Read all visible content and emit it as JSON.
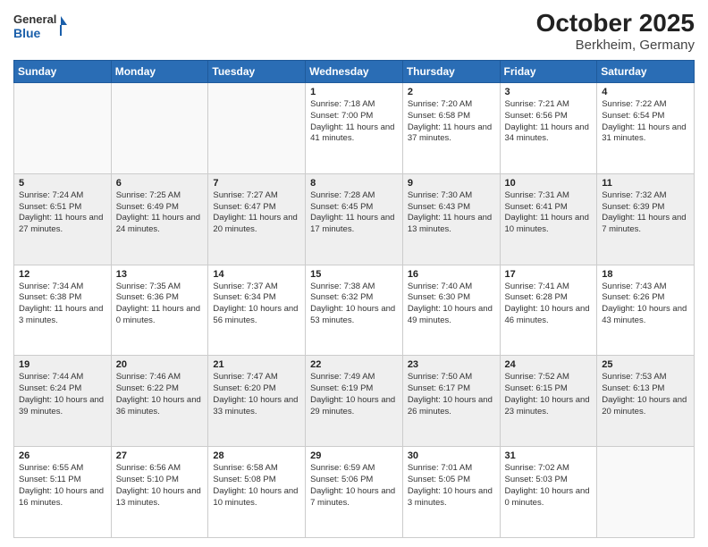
{
  "header": {
    "logo_general": "General",
    "logo_blue": "Blue",
    "month_year": "October 2025",
    "location": "Berkheim, Germany"
  },
  "days_of_week": [
    "Sunday",
    "Monday",
    "Tuesday",
    "Wednesday",
    "Thursday",
    "Friday",
    "Saturday"
  ],
  "weeks": [
    [
      {
        "day": "",
        "info": ""
      },
      {
        "day": "",
        "info": ""
      },
      {
        "day": "",
        "info": ""
      },
      {
        "day": "1",
        "info": "Sunrise: 7:18 AM\nSunset: 7:00 PM\nDaylight: 11 hours and 41 minutes."
      },
      {
        "day": "2",
        "info": "Sunrise: 7:20 AM\nSunset: 6:58 PM\nDaylight: 11 hours and 37 minutes."
      },
      {
        "day": "3",
        "info": "Sunrise: 7:21 AM\nSunset: 6:56 PM\nDaylight: 11 hours and 34 minutes."
      },
      {
        "day": "4",
        "info": "Sunrise: 7:22 AM\nSunset: 6:54 PM\nDaylight: 11 hours and 31 minutes."
      }
    ],
    [
      {
        "day": "5",
        "info": "Sunrise: 7:24 AM\nSunset: 6:51 PM\nDaylight: 11 hours and 27 minutes."
      },
      {
        "day": "6",
        "info": "Sunrise: 7:25 AM\nSunset: 6:49 PM\nDaylight: 11 hours and 24 minutes."
      },
      {
        "day": "7",
        "info": "Sunrise: 7:27 AM\nSunset: 6:47 PM\nDaylight: 11 hours and 20 minutes."
      },
      {
        "day": "8",
        "info": "Sunrise: 7:28 AM\nSunset: 6:45 PM\nDaylight: 11 hours and 17 minutes."
      },
      {
        "day": "9",
        "info": "Sunrise: 7:30 AM\nSunset: 6:43 PM\nDaylight: 11 hours and 13 minutes."
      },
      {
        "day": "10",
        "info": "Sunrise: 7:31 AM\nSunset: 6:41 PM\nDaylight: 11 hours and 10 minutes."
      },
      {
        "day": "11",
        "info": "Sunrise: 7:32 AM\nSunset: 6:39 PM\nDaylight: 11 hours and 7 minutes."
      }
    ],
    [
      {
        "day": "12",
        "info": "Sunrise: 7:34 AM\nSunset: 6:38 PM\nDaylight: 11 hours and 3 minutes."
      },
      {
        "day": "13",
        "info": "Sunrise: 7:35 AM\nSunset: 6:36 PM\nDaylight: 11 hours and 0 minutes."
      },
      {
        "day": "14",
        "info": "Sunrise: 7:37 AM\nSunset: 6:34 PM\nDaylight: 10 hours and 56 minutes."
      },
      {
        "day": "15",
        "info": "Sunrise: 7:38 AM\nSunset: 6:32 PM\nDaylight: 10 hours and 53 minutes."
      },
      {
        "day": "16",
        "info": "Sunrise: 7:40 AM\nSunset: 6:30 PM\nDaylight: 10 hours and 49 minutes."
      },
      {
        "day": "17",
        "info": "Sunrise: 7:41 AM\nSunset: 6:28 PM\nDaylight: 10 hours and 46 minutes."
      },
      {
        "day": "18",
        "info": "Sunrise: 7:43 AM\nSunset: 6:26 PM\nDaylight: 10 hours and 43 minutes."
      }
    ],
    [
      {
        "day": "19",
        "info": "Sunrise: 7:44 AM\nSunset: 6:24 PM\nDaylight: 10 hours and 39 minutes."
      },
      {
        "day": "20",
        "info": "Sunrise: 7:46 AM\nSunset: 6:22 PM\nDaylight: 10 hours and 36 minutes."
      },
      {
        "day": "21",
        "info": "Sunrise: 7:47 AM\nSunset: 6:20 PM\nDaylight: 10 hours and 33 minutes."
      },
      {
        "day": "22",
        "info": "Sunrise: 7:49 AM\nSunset: 6:19 PM\nDaylight: 10 hours and 29 minutes."
      },
      {
        "day": "23",
        "info": "Sunrise: 7:50 AM\nSunset: 6:17 PM\nDaylight: 10 hours and 26 minutes."
      },
      {
        "day": "24",
        "info": "Sunrise: 7:52 AM\nSunset: 6:15 PM\nDaylight: 10 hours and 23 minutes."
      },
      {
        "day": "25",
        "info": "Sunrise: 7:53 AM\nSunset: 6:13 PM\nDaylight: 10 hours and 20 minutes."
      }
    ],
    [
      {
        "day": "26",
        "info": "Sunrise: 6:55 AM\nSunset: 5:11 PM\nDaylight: 10 hours and 16 minutes."
      },
      {
        "day": "27",
        "info": "Sunrise: 6:56 AM\nSunset: 5:10 PM\nDaylight: 10 hours and 13 minutes."
      },
      {
        "day": "28",
        "info": "Sunrise: 6:58 AM\nSunset: 5:08 PM\nDaylight: 10 hours and 10 minutes."
      },
      {
        "day": "29",
        "info": "Sunrise: 6:59 AM\nSunset: 5:06 PM\nDaylight: 10 hours and 7 minutes."
      },
      {
        "day": "30",
        "info": "Sunrise: 7:01 AM\nSunset: 5:05 PM\nDaylight: 10 hours and 3 minutes."
      },
      {
        "day": "31",
        "info": "Sunrise: 7:02 AM\nSunset: 5:03 PM\nDaylight: 10 hours and 0 minutes."
      },
      {
        "day": "",
        "info": ""
      }
    ]
  ]
}
